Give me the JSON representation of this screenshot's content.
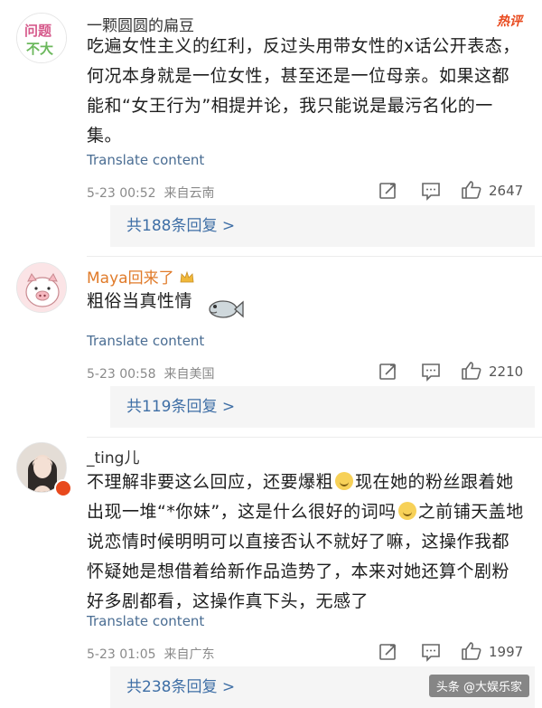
{
  "comments": [
    {
      "username": "一颗圆圆的扁豆",
      "badge": "热评",
      "avatar_text": "问题不大",
      "text": "吃遍女性主义的红利，反过头用带女性的x话公开表态，何况本身就是一位女性，甚至还是一位母亲。如果这都能和“女王行为”相提并论，我只能说是最污名化的一集。",
      "translate": "Translate content",
      "time": "5-23 00:52",
      "location": "来自云南",
      "likes": "2647",
      "replies": "共188条回复 >"
    },
    {
      "username": "Maya回来了",
      "text": "粗俗当真性情",
      "translate": "Translate content",
      "time": "5-23 00:58",
      "location": "来自美国",
      "likes": "2210",
      "replies": "共119条回复 >"
    },
    {
      "username": "_ting儿",
      "text_parts": [
        "不理解非要这么回应，还要爆粗",
        "现在她的粉丝跟着她出现一堆“*你妹”，这是什么很好的词吗",
        "之前铺天盖地说恋情时候明明可以直接否认不就好了嘛，这操作我都怀疑她是想借着给新作品造势了，本来对她还算个剧粉好多剧都看，这操作真下头，无感了"
      ],
      "translate": "Translate content",
      "time": "5-23 01:05",
      "location": "来自广东",
      "likes": "1997",
      "replies": "共238条回复 >"
    }
  ],
  "watermark": "头条 @大娱乐家",
  "colors": {
    "link": "#4a6d93",
    "replies": "#3f6fa6",
    "hot": "#e8491d",
    "maya_name": "#e07b2a"
  }
}
